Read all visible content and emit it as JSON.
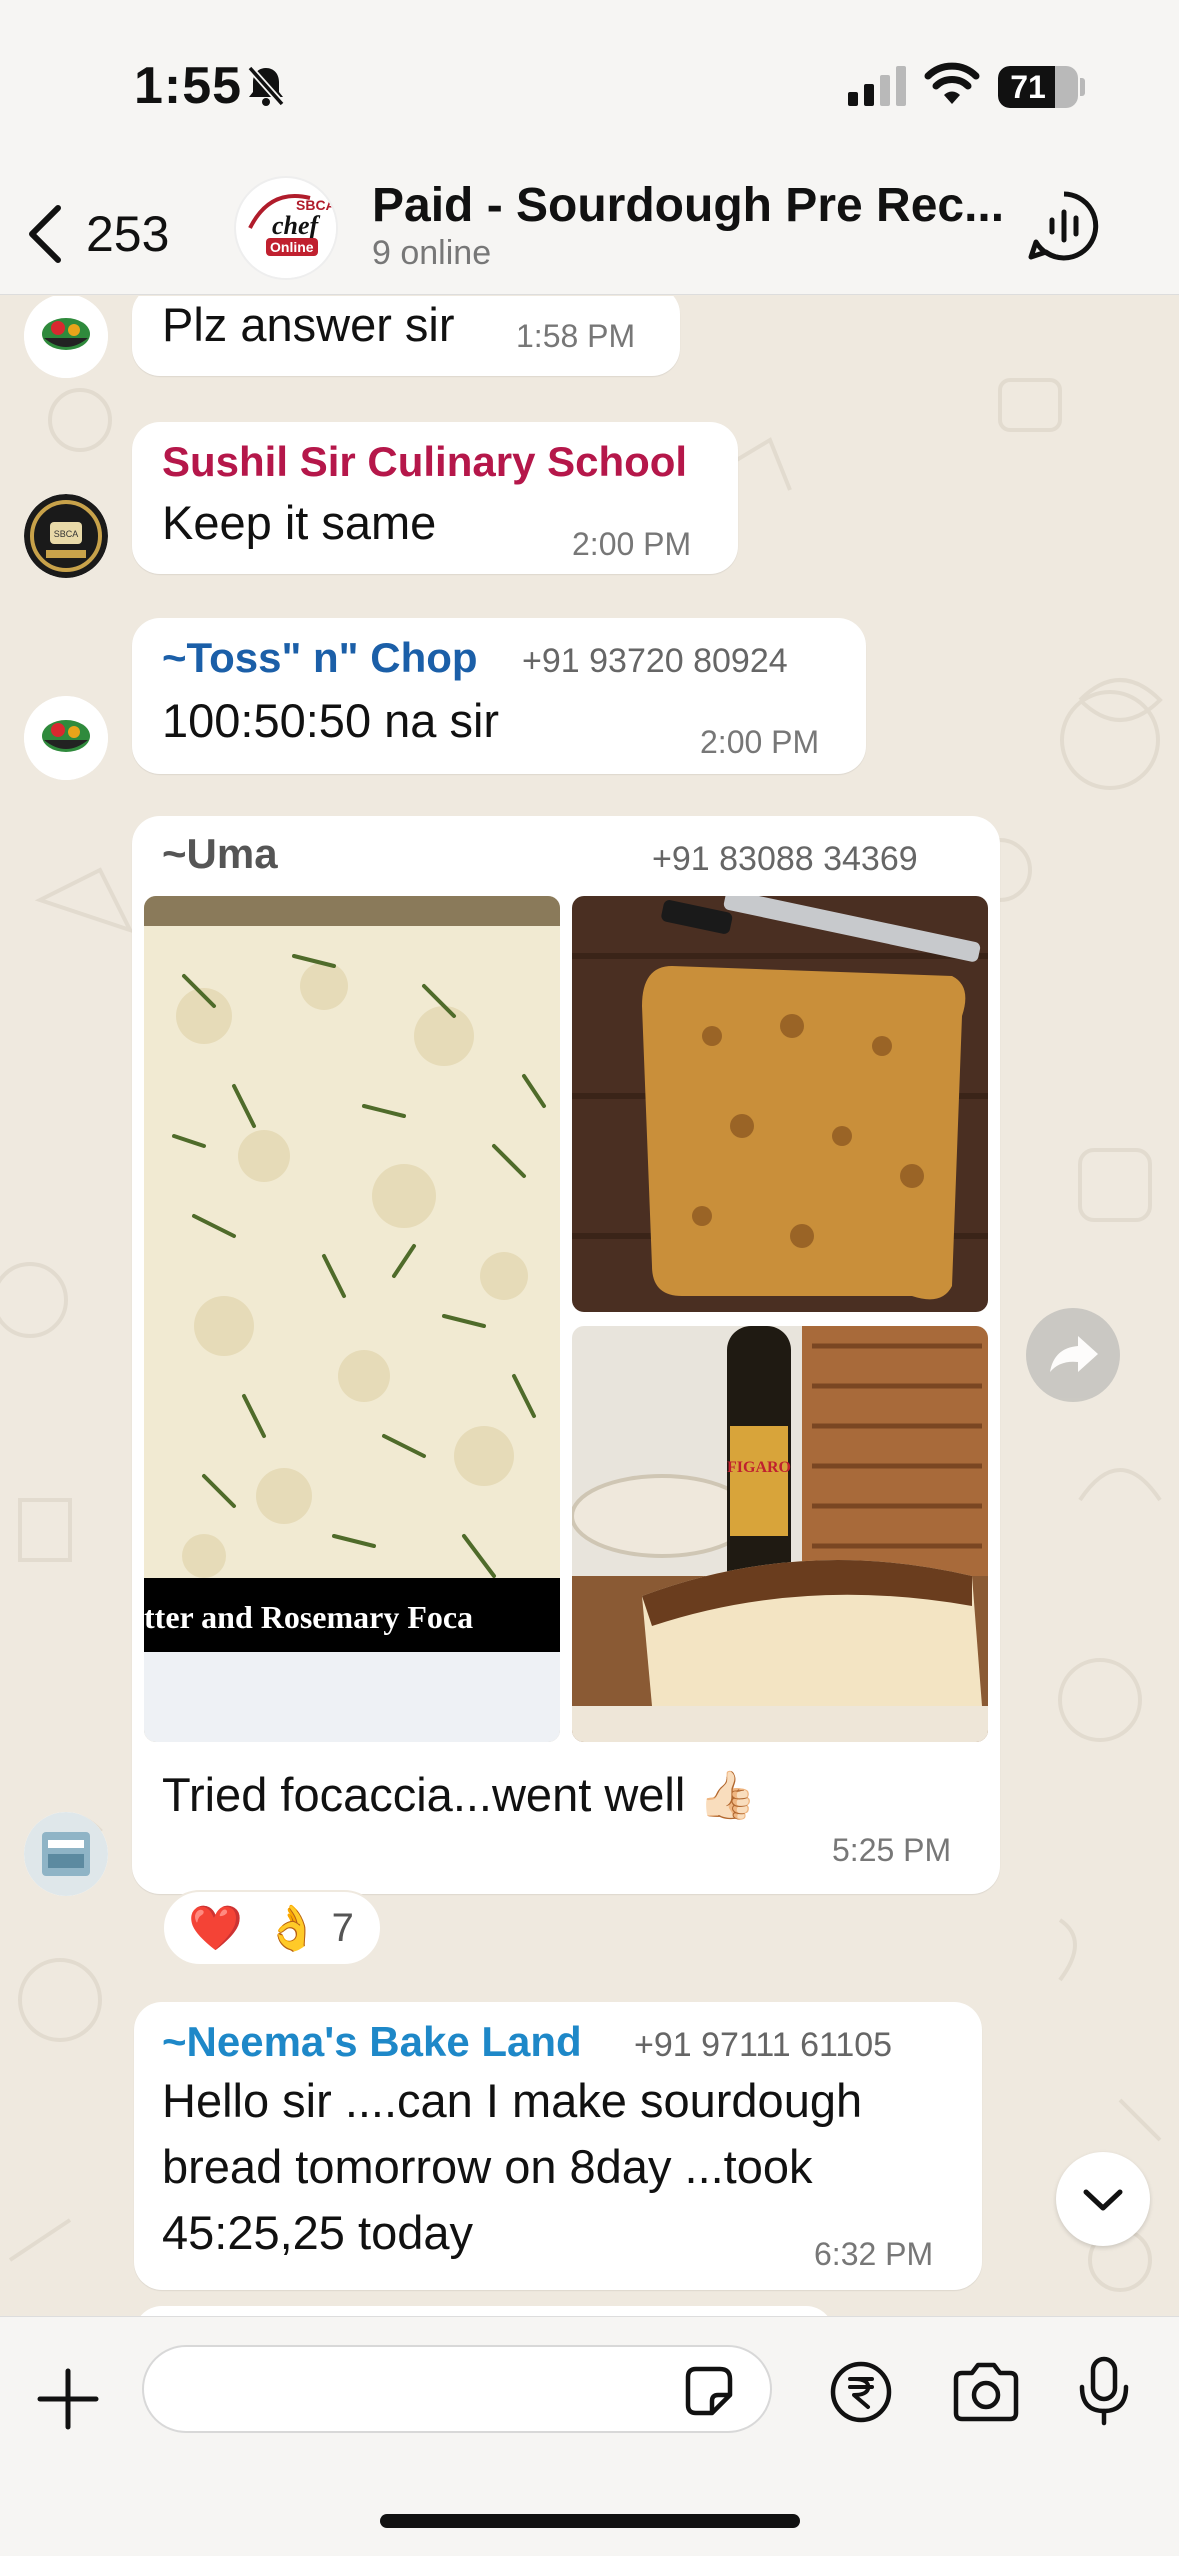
{
  "status_bar": {
    "time": "1:55",
    "battery": "71",
    "battery_level": 0.71
  },
  "header": {
    "back_count": "253",
    "title": "Paid - Sourdough Pre Rec...",
    "subtitle": "9 online",
    "avatar_text_top": "SBCA",
    "avatar_text_mid": "chef",
    "avatar_text_bottom": "Online"
  },
  "messages": [
    {
      "text": "Plz answer sir",
      "time": "1:58 PM"
    },
    {
      "sender": "Sushil Sir Culinary School",
      "text": "Keep it same",
      "time": "2:00 PM",
      "avatar_text": "SBCA"
    },
    {
      "sender": "~Toss\" n\" Chop",
      "phone": "+91 93720 80924",
      "text": "100:50:50 na sir",
      "time": "2:00 PM"
    },
    {
      "sender": "~Uma",
      "phone": "+91 83088 34369",
      "photo_caption": "tter and Rosemary Foca",
      "bottle_label": "FIGARO",
      "text": "Tried focaccia...went well 👍🏻",
      "time": "5:25 PM",
      "reactions": {
        "emojis": [
          "❤️",
          "👌"
        ],
        "count": "7"
      }
    },
    {
      "sender": "~Neema's Bake Land",
      "phone": "+91 97111 61105",
      "text_lines": [
        "Hello sir ....can I make sourdough",
        "bread tomorrow on 8day ...took",
        "45:25,25 today"
      ],
      "time": "6:32 PM"
    }
  ],
  "composer": {
    "placeholder": ""
  },
  "colors": {
    "sushil": "#b5174a",
    "toss": "#1b5fa8",
    "uma": "#555555",
    "neema": "#1e88c8",
    "bubble": "#ffffff",
    "wallpaper": "#efe9df"
  },
  "icons": [
    "bell-off-icon",
    "signal-icon",
    "wifi-icon",
    "battery-icon",
    "back-chevron-icon",
    "voice-chat-icon",
    "forward-icon",
    "chevron-down-icon",
    "plus-icon",
    "sticker-icon",
    "rupee-icon",
    "camera-icon",
    "mic-icon"
  ]
}
